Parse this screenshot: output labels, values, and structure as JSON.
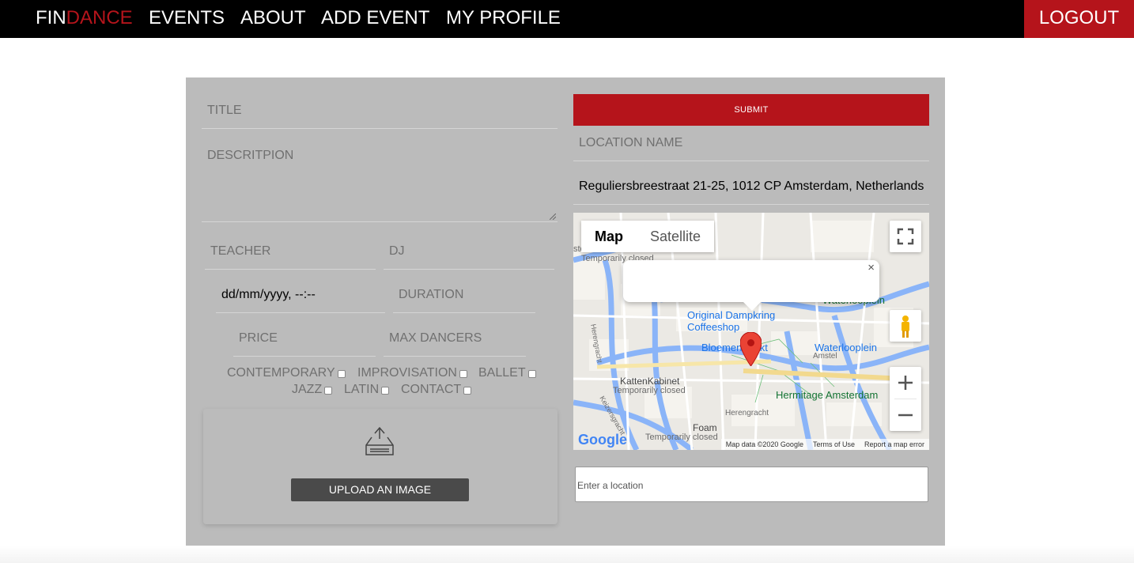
{
  "nav": {
    "brand_part1": "FIN",
    "brand_part2": "DANCE",
    "events": "EVENTS",
    "about": "ABOUT",
    "add_event": "ADD EVENT",
    "my_profile": "MY PROFILE",
    "logout": "LOGOUT"
  },
  "colors": {
    "brand_red": "#b5141b",
    "card_bg": "#bbbbbb",
    "nav_bg": "#000000"
  },
  "form": {
    "title_placeholder": "TITLE",
    "description_placeholder": "DESCRITPION",
    "teacher_placeholder": "TEACHER",
    "dj_placeholder": "DJ",
    "datetime_value": "dd/mm/yyyy, --:--",
    "duration_placeholder": "DURATION",
    "price_placeholder": "PRICE",
    "max_dancers_placeholder": "MAX DANCERS",
    "styles": [
      "CONTEMPORARY",
      "IMPROVISATION",
      "BALLET",
      "JAZZ",
      "LATIN",
      "CONTACT"
    ],
    "upload_label": "UPLOAD AN IMAGE",
    "upload_icon": "inbox-tray-icon",
    "submit_label": "SUBMIT",
    "location_name_placeholder": "LOCATION NAME",
    "address_value": "Reguliersbreestraat 21-25, 1012 CP Amsterdam, Netherlands",
    "location_search_placeholder": "Enter a location"
  },
  "map": {
    "type_map": "Map",
    "type_satellite": "Satellite",
    "popup_close": "×",
    "labels": {
      "dampkring": "Original Dampkring",
      "coffeeshop": "Coffeeshop",
      "bloemenmarkt": "Bloemenmarkt",
      "waterlooplein": "Waterlooplein",
      "waterlooplein_market": "Waterlooplein",
      "hermitage": "Hermitage Amsterdam",
      "kattenkabinet": "KattenKabinet",
      "temp_closed_1": "Temporarily closed",
      "temp_closed_2": "Temporarily closed",
      "temp_closed_3": "Temporarily closed",
      "foam": "Foam",
      "museum": "sterdam Museum",
      "amstel": "Amstel",
      "herengracht": "Herengracht",
      "herengracht2": "Herengracht",
      "keizersgracht": "Keizersgracht"
    },
    "google": "Google",
    "map_data": "Map data ©2020 Google",
    "terms": "Terms of Use",
    "report": "Report a map error"
  }
}
